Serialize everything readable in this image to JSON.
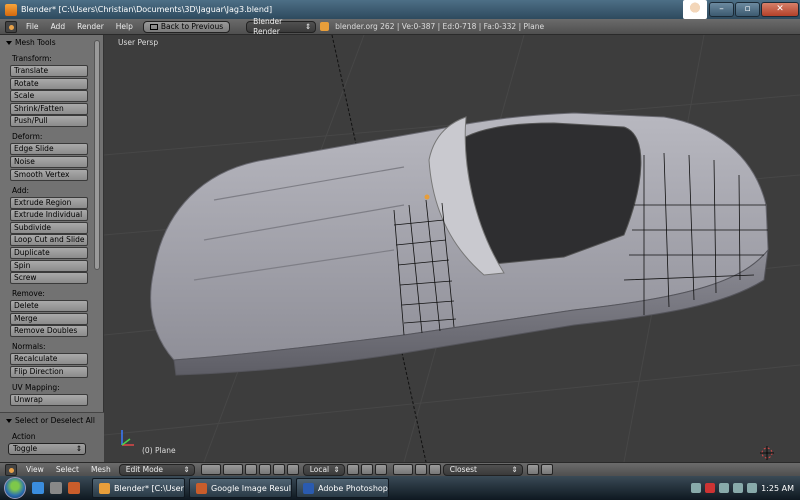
{
  "window": {
    "title": "Blender* [C:\\Users\\Christian\\Documents\\3D\\Jaguar\\Jag3.blend]",
    "minimize": "–",
    "maximize": "▫",
    "close": "✕"
  },
  "header": {
    "menus": [
      "File",
      "Add",
      "Render",
      "Help"
    ],
    "back_button": "Back to Previous",
    "render_engine": "Blender Render",
    "stats": "blender.org 262 | Ve:0-387 | Ed:0-718 | Fa:0-332 | Plane"
  },
  "toolshelf": {
    "title": "Mesh Tools",
    "sections": [
      {
        "label": "Transform:",
        "buttons": [
          "Translate",
          "Rotate",
          "Scale",
          "Shrink/Fatten",
          "Push/Pull"
        ]
      },
      {
        "label": "Deform:",
        "buttons": [
          "Edge Slide",
          "Noise",
          "Smooth Vertex"
        ]
      },
      {
        "label": "Add:",
        "buttons": [
          "Extrude Region",
          "Extrude Individual",
          "Subdivide",
          "Loop Cut and Slide",
          "Duplicate",
          "Spin",
          "Screw"
        ]
      },
      {
        "label": "Remove:",
        "buttons": [
          "Delete",
          "Merge",
          "Remove Doubles"
        ]
      },
      {
        "label": "Normals:",
        "buttons": [
          "Recalculate",
          "Flip Direction"
        ]
      },
      {
        "label": "UV Mapping:",
        "buttons": [
          "Unwrap"
        ]
      }
    ],
    "operator_panel": {
      "title": "Select or Deselect All",
      "action_label": "Action",
      "action_value": "Toggle"
    }
  },
  "viewport": {
    "view_name": "User Persp",
    "object_name": "(0) Plane"
  },
  "bottom_header": {
    "menus": [
      "View",
      "Select",
      "Mesh"
    ],
    "mode": "Edit Mode",
    "orientation": "Local",
    "snap_target": "Closest"
  },
  "taskbar": {
    "tasks": [
      "Blender* [C:\\Users\\...",
      "Google Image Resul...",
      "Adobe Photoshop - ..."
    ],
    "clock": "1:25 AM"
  },
  "colors": {
    "viewport_bg": "#3d3d3d",
    "panel_bg": "#727272",
    "accent": "#e89e3a"
  }
}
